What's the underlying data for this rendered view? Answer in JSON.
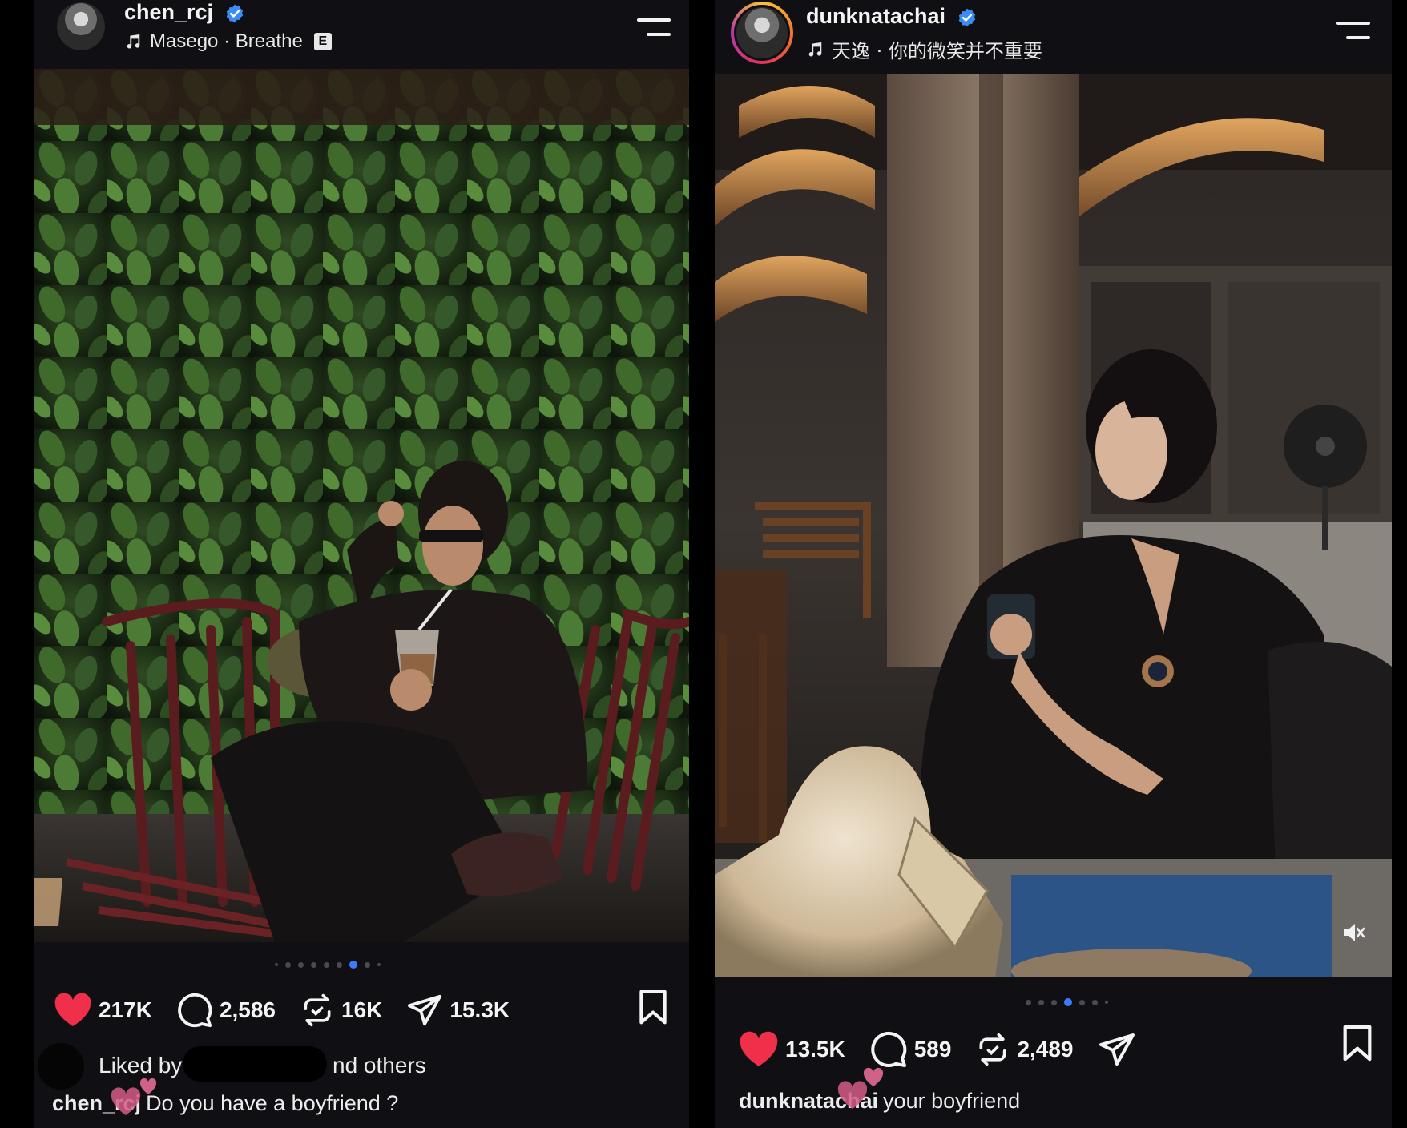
{
  "posts": [
    {
      "username": "chen_rcj",
      "music_artist": "Masego",
      "music_separator": "·",
      "music_title": "Breathe",
      "explicit_label": "E",
      "likes": "217K",
      "comments": "2,586",
      "reposts": "16K",
      "shares": "15.3K",
      "liked_by_prefix": "Liked by",
      "liked_by_suffix": "nd others",
      "caption_user": "chen_rcj",
      "caption_text": "Do you have a boyfriend ?",
      "carousel_index": 7,
      "carousel_total": 9
    },
    {
      "username": "dunknatachai",
      "music_artist": "天逸",
      "music_separator": "·",
      "music_title": "你的微笑并不重要",
      "likes": "13.5K",
      "comments": "589",
      "reposts": "2,489",
      "caption_user": "dunknatachai",
      "caption_text": "your boyfriend",
      "carousel_index": 4,
      "carousel_total": 7
    }
  ],
  "colors": {
    "background": "#000000",
    "panel": "#101014",
    "heart": "#f0304a",
    "verified": "#3b8cf5",
    "active_dot": "#3c7bff"
  },
  "icons": [
    "music-note-icon",
    "verified-badge-icon",
    "menu-icon",
    "heart-icon",
    "comment-icon",
    "repost-icon",
    "share-icon",
    "bookmark-icon",
    "mute-icon"
  ]
}
